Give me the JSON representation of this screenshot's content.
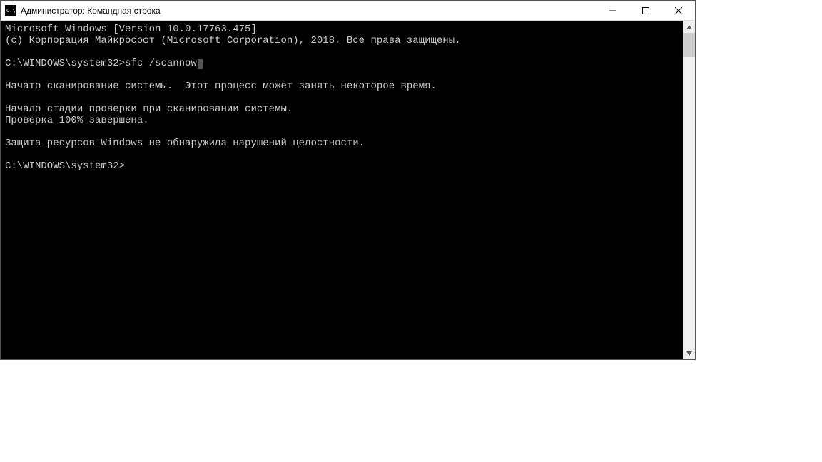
{
  "titlebar": {
    "title": "Администратор: Командная строка"
  },
  "console": {
    "line1": "Microsoft Windows [Version 10.0.17763.475]",
    "line2": "(c) Корпорация Майкрософт (Microsoft Corporation), 2018. Все права защищены.",
    "prompt1": "C:\\WINDOWS\\system32>",
    "command1": "sfc /scannow",
    "line3": "Начато сканирование системы.  Этот процесс может занять некоторое время.",
    "line4": "Начало стадии проверки при сканировании системы.",
    "line5": "Проверка 100% завершена.",
    "line6": "Защита ресурсов Windows не обнаружила нарушений целостности.",
    "prompt2": "C:\\WINDOWS\\system32>"
  }
}
